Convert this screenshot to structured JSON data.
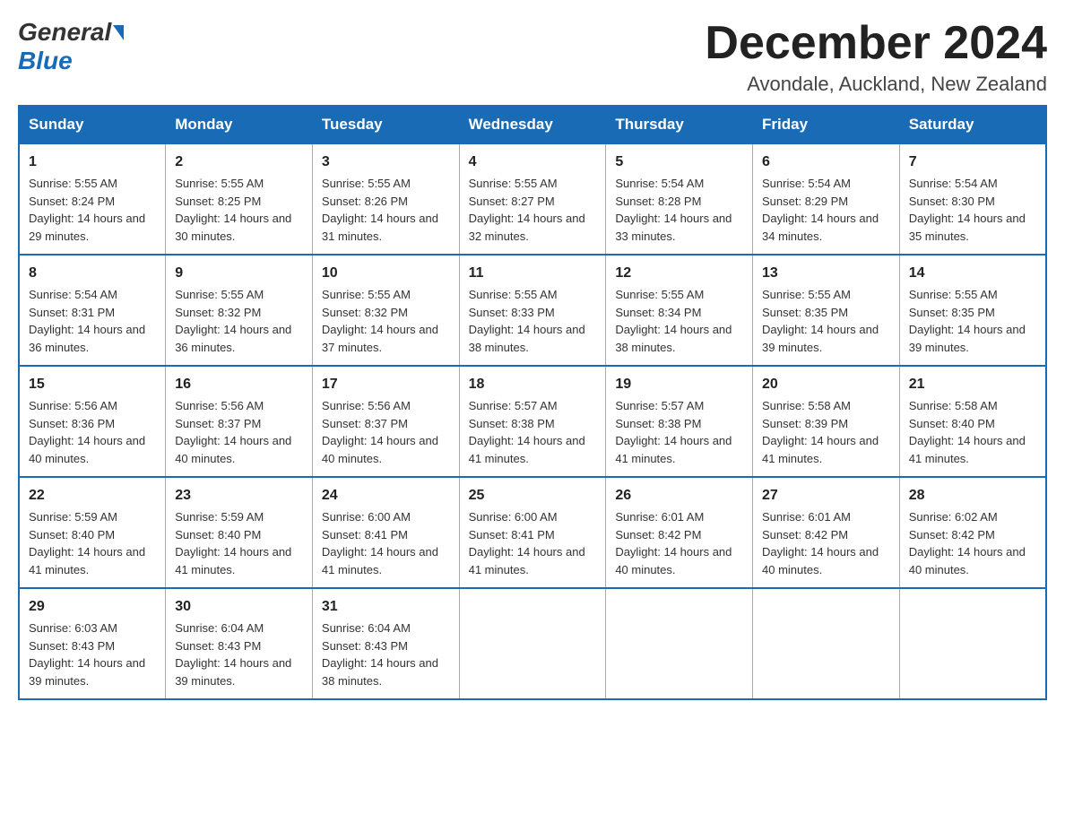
{
  "header": {
    "logo_general": "General",
    "logo_blue": "Blue",
    "month_title": "December 2024",
    "location": "Avondale, Auckland, New Zealand"
  },
  "days_of_week": [
    "Sunday",
    "Monday",
    "Tuesday",
    "Wednesday",
    "Thursday",
    "Friday",
    "Saturday"
  ],
  "weeks": [
    [
      {
        "day": "1",
        "sunrise": "Sunrise: 5:55 AM",
        "sunset": "Sunset: 8:24 PM",
        "daylight": "Daylight: 14 hours and 29 minutes."
      },
      {
        "day": "2",
        "sunrise": "Sunrise: 5:55 AM",
        "sunset": "Sunset: 8:25 PM",
        "daylight": "Daylight: 14 hours and 30 minutes."
      },
      {
        "day": "3",
        "sunrise": "Sunrise: 5:55 AM",
        "sunset": "Sunset: 8:26 PM",
        "daylight": "Daylight: 14 hours and 31 minutes."
      },
      {
        "day": "4",
        "sunrise": "Sunrise: 5:55 AM",
        "sunset": "Sunset: 8:27 PM",
        "daylight": "Daylight: 14 hours and 32 minutes."
      },
      {
        "day": "5",
        "sunrise": "Sunrise: 5:54 AM",
        "sunset": "Sunset: 8:28 PM",
        "daylight": "Daylight: 14 hours and 33 minutes."
      },
      {
        "day": "6",
        "sunrise": "Sunrise: 5:54 AM",
        "sunset": "Sunset: 8:29 PM",
        "daylight": "Daylight: 14 hours and 34 minutes."
      },
      {
        "day": "7",
        "sunrise": "Sunrise: 5:54 AM",
        "sunset": "Sunset: 8:30 PM",
        "daylight": "Daylight: 14 hours and 35 minutes."
      }
    ],
    [
      {
        "day": "8",
        "sunrise": "Sunrise: 5:54 AM",
        "sunset": "Sunset: 8:31 PM",
        "daylight": "Daylight: 14 hours and 36 minutes."
      },
      {
        "day": "9",
        "sunrise": "Sunrise: 5:55 AM",
        "sunset": "Sunset: 8:32 PM",
        "daylight": "Daylight: 14 hours and 36 minutes."
      },
      {
        "day": "10",
        "sunrise": "Sunrise: 5:55 AM",
        "sunset": "Sunset: 8:32 PM",
        "daylight": "Daylight: 14 hours and 37 minutes."
      },
      {
        "day": "11",
        "sunrise": "Sunrise: 5:55 AM",
        "sunset": "Sunset: 8:33 PM",
        "daylight": "Daylight: 14 hours and 38 minutes."
      },
      {
        "day": "12",
        "sunrise": "Sunrise: 5:55 AM",
        "sunset": "Sunset: 8:34 PM",
        "daylight": "Daylight: 14 hours and 38 minutes."
      },
      {
        "day": "13",
        "sunrise": "Sunrise: 5:55 AM",
        "sunset": "Sunset: 8:35 PM",
        "daylight": "Daylight: 14 hours and 39 minutes."
      },
      {
        "day": "14",
        "sunrise": "Sunrise: 5:55 AM",
        "sunset": "Sunset: 8:35 PM",
        "daylight": "Daylight: 14 hours and 39 minutes."
      }
    ],
    [
      {
        "day": "15",
        "sunrise": "Sunrise: 5:56 AM",
        "sunset": "Sunset: 8:36 PM",
        "daylight": "Daylight: 14 hours and 40 minutes."
      },
      {
        "day": "16",
        "sunrise": "Sunrise: 5:56 AM",
        "sunset": "Sunset: 8:37 PM",
        "daylight": "Daylight: 14 hours and 40 minutes."
      },
      {
        "day": "17",
        "sunrise": "Sunrise: 5:56 AM",
        "sunset": "Sunset: 8:37 PM",
        "daylight": "Daylight: 14 hours and 40 minutes."
      },
      {
        "day": "18",
        "sunrise": "Sunrise: 5:57 AM",
        "sunset": "Sunset: 8:38 PM",
        "daylight": "Daylight: 14 hours and 41 minutes."
      },
      {
        "day": "19",
        "sunrise": "Sunrise: 5:57 AM",
        "sunset": "Sunset: 8:38 PM",
        "daylight": "Daylight: 14 hours and 41 minutes."
      },
      {
        "day": "20",
        "sunrise": "Sunrise: 5:58 AM",
        "sunset": "Sunset: 8:39 PM",
        "daylight": "Daylight: 14 hours and 41 minutes."
      },
      {
        "day": "21",
        "sunrise": "Sunrise: 5:58 AM",
        "sunset": "Sunset: 8:40 PM",
        "daylight": "Daylight: 14 hours and 41 minutes."
      }
    ],
    [
      {
        "day": "22",
        "sunrise": "Sunrise: 5:59 AM",
        "sunset": "Sunset: 8:40 PM",
        "daylight": "Daylight: 14 hours and 41 minutes."
      },
      {
        "day": "23",
        "sunrise": "Sunrise: 5:59 AM",
        "sunset": "Sunset: 8:40 PM",
        "daylight": "Daylight: 14 hours and 41 minutes."
      },
      {
        "day": "24",
        "sunrise": "Sunrise: 6:00 AM",
        "sunset": "Sunset: 8:41 PM",
        "daylight": "Daylight: 14 hours and 41 minutes."
      },
      {
        "day": "25",
        "sunrise": "Sunrise: 6:00 AM",
        "sunset": "Sunset: 8:41 PM",
        "daylight": "Daylight: 14 hours and 41 minutes."
      },
      {
        "day": "26",
        "sunrise": "Sunrise: 6:01 AM",
        "sunset": "Sunset: 8:42 PM",
        "daylight": "Daylight: 14 hours and 40 minutes."
      },
      {
        "day": "27",
        "sunrise": "Sunrise: 6:01 AM",
        "sunset": "Sunset: 8:42 PM",
        "daylight": "Daylight: 14 hours and 40 minutes."
      },
      {
        "day": "28",
        "sunrise": "Sunrise: 6:02 AM",
        "sunset": "Sunset: 8:42 PM",
        "daylight": "Daylight: 14 hours and 40 minutes."
      }
    ],
    [
      {
        "day": "29",
        "sunrise": "Sunrise: 6:03 AM",
        "sunset": "Sunset: 8:43 PM",
        "daylight": "Daylight: 14 hours and 39 minutes."
      },
      {
        "day": "30",
        "sunrise": "Sunrise: 6:04 AM",
        "sunset": "Sunset: 8:43 PM",
        "daylight": "Daylight: 14 hours and 39 minutes."
      },
      {
        "day": "31",
        "sunrise": "Sunrise: 6:04 AM",
        "sunset": "Sunset: 8:43 PM",
        "daylight": "Daylight: 14 hours and 38 minutes."
      },
      null,
      null,
      null,
      null
    ]
  ]
}
